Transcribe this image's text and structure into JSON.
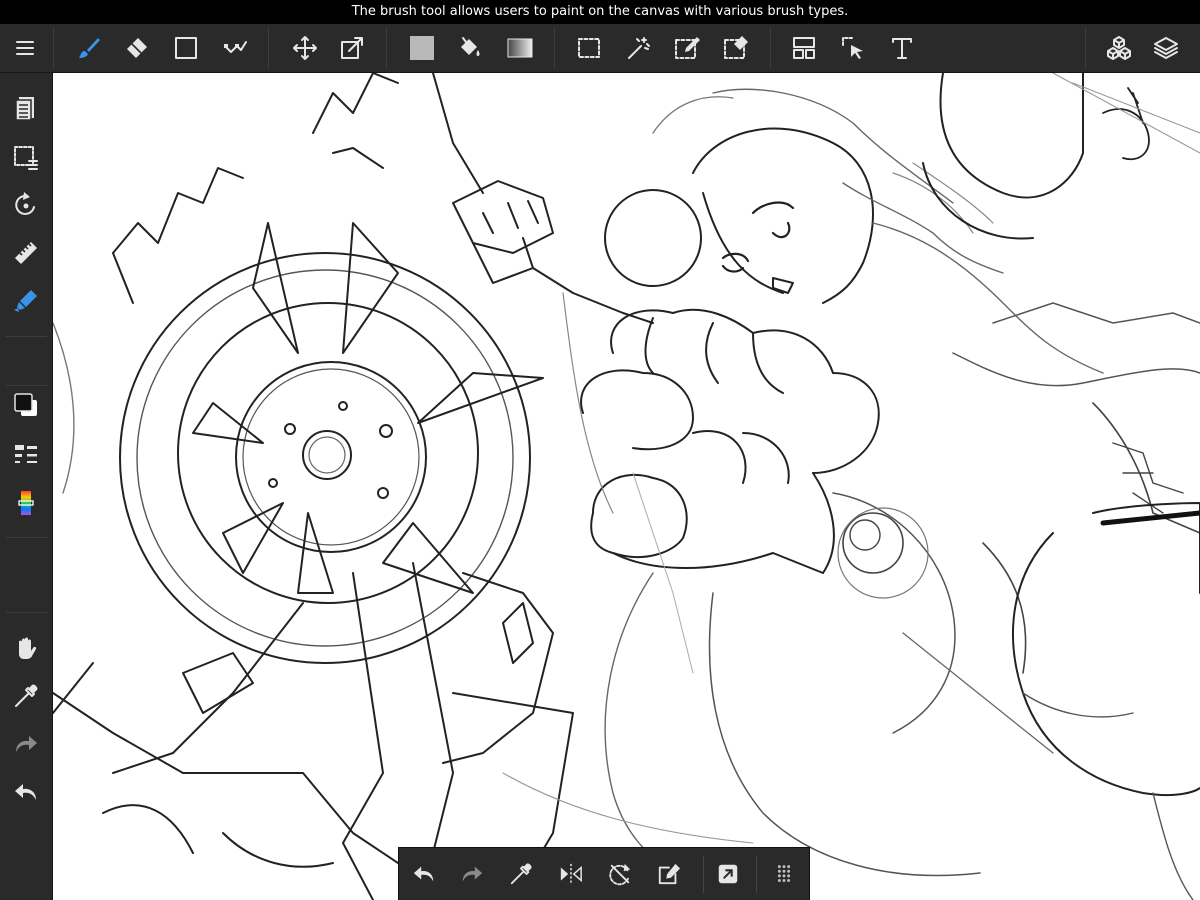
{
  "tooltip": {
    "text": "The brush tool allows users to paint on the canvas with various brush types."
  },
  "colors": {
    "toolbar_bg": "#2a2a2a",
    "active_tool": "#3a93e6",
    "icon": "#e6e6e6",
    "canvas_bg": "#ffffff",
    "primary_color": "#111111",
    "secondary_color": "#ffffff"
  },
  "top_toolbar": {
    "tools": [
      {
        "name": "menu",
        "icon": "hamburger-icon"
      },
      {
        "name": "brush",
        "icon": "brush-icon",
        "active": true
      },
      {
        "name": "eraser",
        "icon": "eraser-icon"
      },
      {
        "name": "shape",
        "icon": "rectangle-icon"
      },
      {
        "name": "correction",
        "icon": "correction-icon"
      },
      {
        "name": "move",
        "icon": "move-icon"
      },
      {
        "name": "transform",
        "icon": "transform-icon"
      },
      {
        "name": "fill color",
        "icon": "fill-swatch-icon"
      },
      {
        "name": "fill",
        "icon": "bucket-icon"
      },
      {
        "name": "gradient",
        "icon": "gradient-icon"
      },
      {
        "name": "selection",
        "icon": "selection-icon"
      },
      {
        "name": "auto select",
        "icon": "magic-wand-icon"
      },
      {
        "name": "selection pen",
        "icon": "selection-pen-icon"
      },
      {
        "name": "selection eraser",
        "icon": "selection-eraser-icon"
      },
      {
        "name": "frame divider",
        "icon": "frame-divider-icon"
      },
      {
        "name": "operation",
        "icon": "operation-icon"
      },
      {
        "name": "text",
        "icon": "text-icon",
        "glyph": "T"
      },
      {
        "name": "3d",
        "icon": "cubes-icon"
      },
      {
        "name": "layers",
        "icon": "layers-icon"
      }
    ]
  },
  "sidebar": {
    "tools": [
      {
        "name": "page manager",
        "icon": "pages-icon"
      },
      {
        "name": "selection layer",
        "icon": "selection-layer-icon"
      },
      {
        "name": "rotate canvas",
        "icon": "rotate-icon"
      },
      {
        "name": "ruler",
        "icon": "ruler-icon"
      },
      {
        "name": "snap",
        "icon": "snap-icon"
      },
      {
        "name": "color",
        "icon": "color-swatch-icon"
      },
      {
        "name": "brush size",
        "icon": "brush-size-icon"
      },
      {
        "name": "color slider",
        "icon": "color-slider-icon"
      },
      {
        "name": "hand",
        "icon": "hand-icon"
      },
      {
        "name": "eyedropper",
        "icon": "eyedropper-icon"
      },
      {
        "name": "redo",
        "icon": "redo-icon"
      },
      {
        "name": "undo",
        "icon": "undo-icon"
      }
    ]
  },
  "quick_bar": {
    "tools": [
      {
        "name": "undo",
        "icon": "undo-icon"
      },
      {
        "name": "redo",
        "icon": "redo-icon"
      },
      {
        "name": "eyedropper",
        "icon": "eyedropper-icon"
      },
      {
        "name": "flip horizontal",
        "icon": "flip-icon"
      },
      {
        "name": "reset rotation",
        "icon": "reset-rotation-icon"
      },
      {
        "name": "transform selection",
        "icon": "edit-selection-icon"
      },
      {
        "name": "external",
        "icon": "external-icon"
      },
      {
        "name": "more",
        "icon": "grip-icon"
      }
    ]
  }
}
